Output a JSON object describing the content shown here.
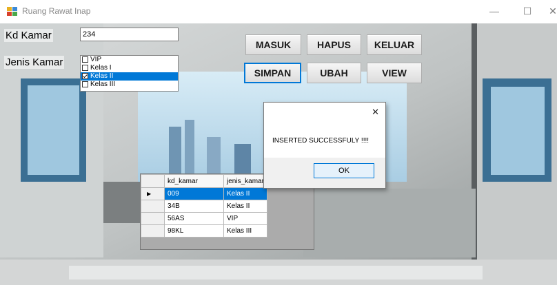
{
  "window": {
    "title": "Ruang Rawat Inap",
    "minimize": "—",
    "maximize": "☐",
    "close": "✕"
  },
  "form": {
    "kd_kamar_label": "Kd Kamar",
    "kd_kamar_value": "234",
    "jenis_kamar_label": "Jenis Kamar",
    "jenis_kamar_options": [
      {
        "label": "VIP",
        "checked": false
      },
      {
        "label": "Kelas I",
        "checked": false
      },
      {
        "label": "Kelas II",
        "checked": true
      },
      {
        "label": "Kelas III",
        "checked": false
      }
    ]
  },
  "buttons": {
    "masuk": "MASUK",
    "hapus": "HAPUS",
    "keluar": "KELUAR",
    "simpan": "SIMPAN",
    "ubah": "UBAH",
    "view": "VIEW"
  },
  "grid": {
    "columns": [
      "kd_kamar",
      "jenis_kamar"
    ],
    "rows": [
      [
        "009",
        "Kelas II"
      ],
      [
        "34B",
        "Kelas II"
      ],
      [
        "56AS",
        "VIP"
      ],
      [
        "98KL",
        "Kelas III"
      ]
    ],
    "current_row_marker": "▶"
  },
  "dialog": {
    "message": "INSERTED SUCCESSFULY !!!!",
    "ok_label": "OK",
    "close": "✕"
  }
}
